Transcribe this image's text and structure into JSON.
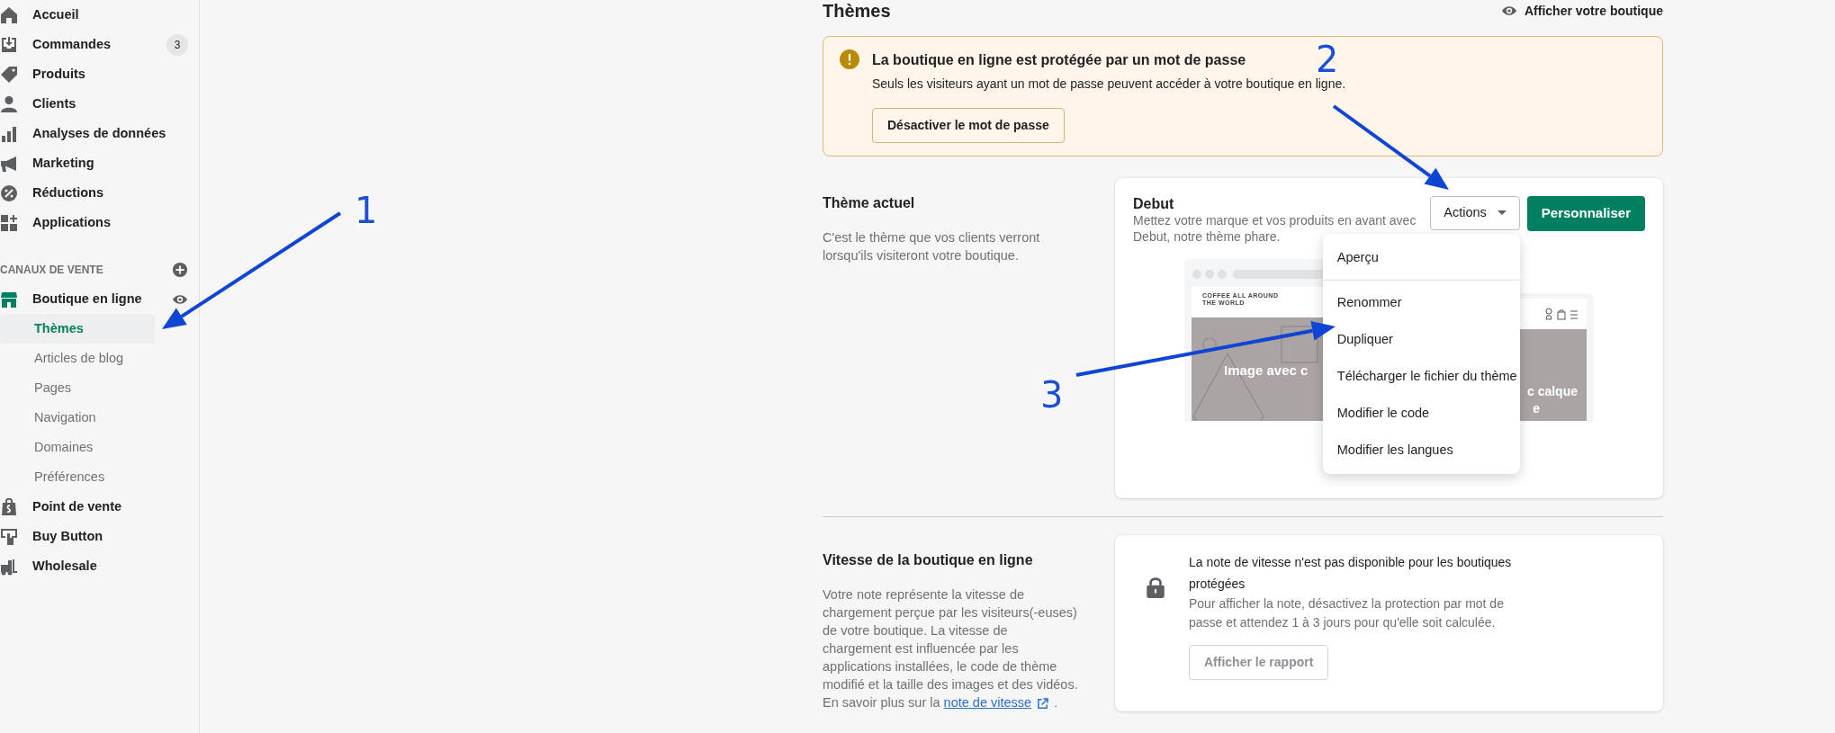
{
  "sidebar": {
    "items": [
      {
        "label": "Accueil"
      },
      {
        "label": "Commandes",
        "badge": "3"
      },
      {
        "label": "Produits"
      },
      {
        "label": "Clients"
      },
      {
        "label": "Analyses de données"
      },
      {
        "label": "Marketing"
      },
      {
        "label": "Réductions"
      },
      {
        "label": "Applications"
      }
    ],
    "sales_channels": {
      "heading": "CANAUX DE VENTE",
      "items": [
        {
          "label": "Boutique en ligne",
          "children": [
            {
              "label": "Thèmes",
              "selected": true
            },
            {
              "label": "Articles de blog",
              "selected": false
            },
            {
              "label": "Pages",
              "selected": false
            },
            {
              "label": "Navigation",
              "selected": false
            },
            {
              "label": "Domaines",
              "selected": false
            },
            {
              "label": "Préférences",
              "selected": false
            }
          ]
        },
        {
          "label": "Point de vente"
        },
        {
          "label": "Buy Button"
        },
        {
          "label": "Wholesale"
        }
      ]
    }
  },
  "page": {
    "title": "Thèmes",
    "view_store_link": "Afficher votre boutique"
  },
  "banner": {
    "title": "La boutique en ligne est protégée par un mot de passe",
    "text": "Seuls les visiteurs ayant un mot de passe peuvent accéder à votre boutique en ligne.",
    "button": "Désactiver le mot de passe"
  },
  "current_theme": {
    "heading": "Thème actuel",
    "description": "C'est le thème que vos clients verront lorsqu'ils visiteront votre boutique.",
    "theme_name": "Debut",
    "theme_description": "Mettez votre marque et vos produits en avant avec Debut, notre thème phare.",
    "actions_button": "Actions",
    "customize_button": "Personnaliser",
    "preview": {
      "store_name": "COFFEE ALL AROUND THE WORLD",
      "desktop_heading": "Image avec c",
      "mobile_heading": "c calque",
      "mobile_heading_2": "e"
    },
    "actions_menu": {
      "open": true,
      "items": [
        {
          "label": "Aperçu"
        },
        {
          "label": "Renommer"
        },
        {
          "label": "Dupliquer"
        },
        {
          "label": "Télécharger le fichier du thème"
        },
        {
          "label": "Modifier le code"
        },
        {
          "label": "Modifier les langues"
        }
      ]
    }
  },
  "speed": {
    "heading": "Vitesse de la boutique en ligne",
    "description": "Votre note représente la vitesse de chargement perçue par les visiteurs(-euses) de votre boutique. La vitesse de chargement est influencée par les applications installées, le code de thème modifié et la taille des images et des vidéos. En savoir plus sur la",
    "link": "note de vitesse",
    "after_link": ".",
    "card_title": "La note de vitesse n'est pas disponible pour les boutiques protégées",
    "card_text": "Pour afficher la note, désactivez la protection par mot de passe et attendez 1 à 3 jours pour qu'elle soit calculée.",
    "report_button": "Afficher le rapport",
    "report_disabled": true
  },
  "annotations": [
    {
      "label": "1"
    },
    {
      "label": "2"
    },
    {
      "label": "3"
    }
  ]
}
